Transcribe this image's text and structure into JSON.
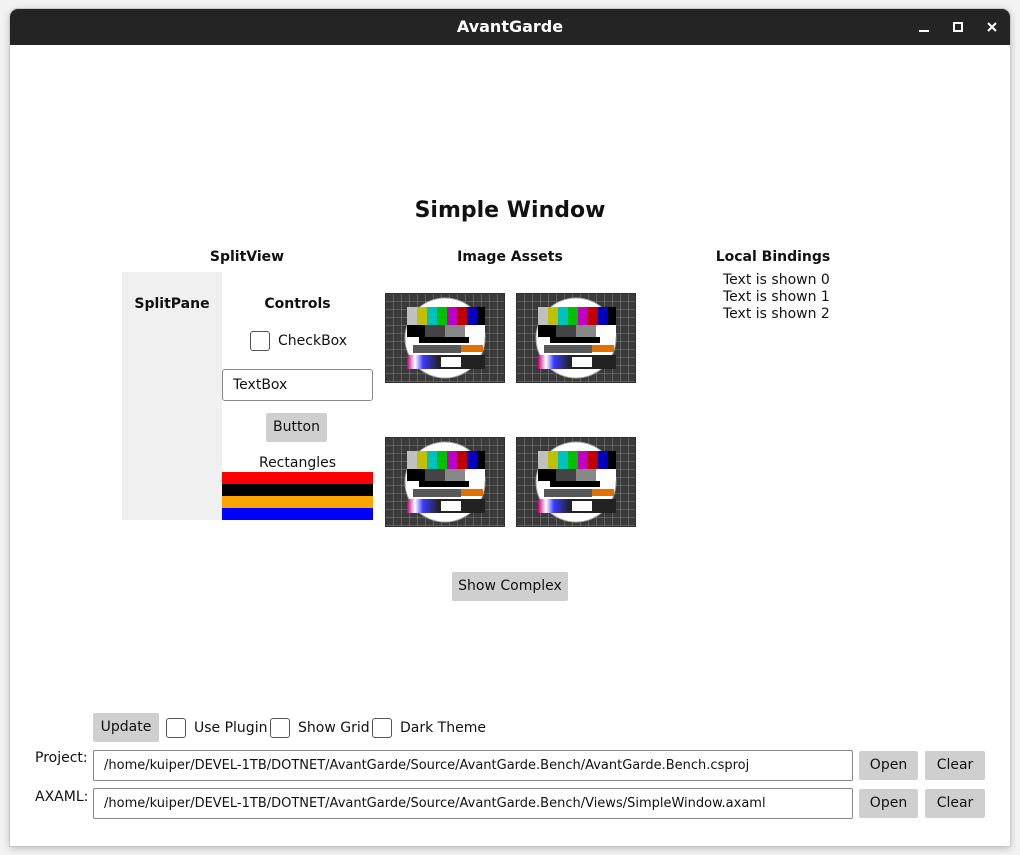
{
  "window": {
    "title": "AvantGarde",
    "controls": [
      "minimize-icon",
      "maximize-icon",
      "close-icon"
    ]
  },
  "preview": {
    "title": "Simple Window",
    "splitview": {
      "heading": "SplitView",
      "pane_label": "SplitPane",
      "controls_heading": "Controls",
      "checkbox_label": "CheckBox",
      "textbox_value": "TextBox",
      "button_label": "Button",
      "rectangles_label": "Rectangles",
      "rectangle_colors": [
        "#ff0000",
        "#000000",
        "#ffa500",
        "#0000ff"
      ]
    },
    "image_assets": {
      "heading": "Image Assets",
      "images": [
        "test-card-image",
        "test-card-image",
        "test-card-image",
        "test-card-image"
      ]
    },
    "local_bindings": {
      "heading": "Local Bindings",
      "items": [
        "Text is shown 0",
        "Text is shown 1",
        "Text is shown 2"
      ]
    },
    "show_complex_label": "Show Complex"
  },
  "toolbar": {
    "update_label": "Update",
    "use_plugin_label": "Use Plugin",
    "show_grid_label": "Show Grid",
    "dark_theme_label": "Dark Theme"
  },
  "project": {
    "label": "Project:",
    "path": "/home/kuiper/DEVEL-1TB/DOTNET/AvantGarde/Source/AvantGarde.Bench/AvantGarde.Bench.csproj",
    "open_label": "Open",
    "clear_label": "Clear"
  },
  "axaml": {
    "label": "AXAML:",
    "path": "/home/kuiper/DEVEL-1TB/DOTNET/AvantGarde/Source/AvantGarde.Bench/Views/SimpleWindow.axaml",
    "open_label": "Open",
    "clear_label": "Clear"
  },
  "colors": {
    "titlebar": "#242424",
    "button": "#cfcfcf",
    "splitpane": "#f0f0f0"
  }
}
